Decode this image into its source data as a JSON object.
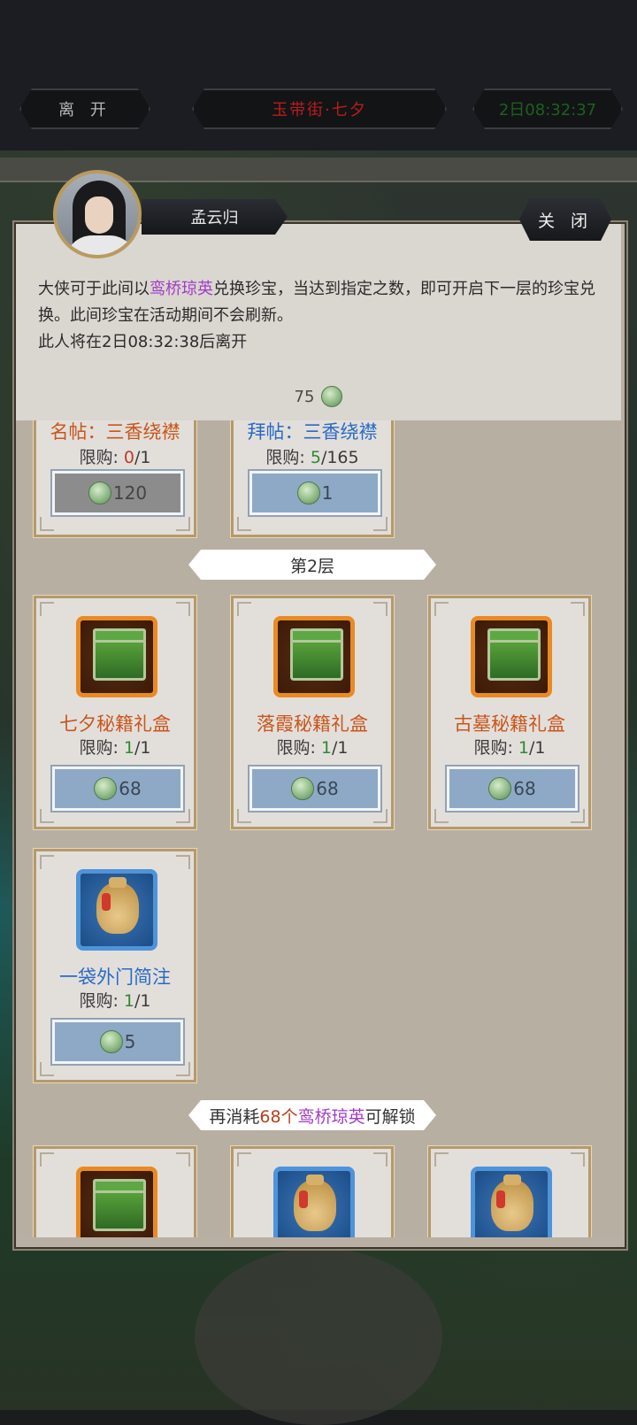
{
  "header": {
    "leave_label": "离 开",
    "location_title": "玉带街·七夕",
    "timer": "2日08:32:37"
  },
  "npc": {
    "name": "孟云归",
    "close_label": "关 闭",
    "desc_part1": "大侠可于此间以",
    "desc_currency": "鸾桥琼英",
    "desc_part2": "兑换珍宝，当达到指定之数，即可开启下一层的珍宝兑换。此间珍宝在活动期间不会刷新。",
    "leave_notice": "此人将在2日08:32:38后离开",
    "currency_amount": "75",
    "currency_icon": "jade-coin-icon"
  },
  "shop": {
    "limit_prefix": "限购: ",
    "tier1_items": [
      {
        "name": "名帖：三香绕襟",
        "color": "orange",
        "bought": "0",
        "max": "1",
        "price": "120",
        "price_state": "disabled"
      },
      {
        "name": "拜帖：三香绕襟",
        "color": "blue",
        "bought": "5",
        "max": "165",
        "price": "1",
        "price_state": "enabled"
      }
    ],
    "tier2_label": "第2层",
    "tier2_items": [
      {
        "name": "七夕秘籍礼盒",
        "color": "orange",
        "icon": "green-chest-icon",
        "bought": "1",
        "max": "1",
        "price": "68"
      },
      {
        "name": "落霞秘籍礼盒",
        "color": "orange",
        "icon": "green-chest-icon",
        "bought": "1",
        "max": "1",
        "price": "68"
      },
      {
        "name": "古墓秘籍礼盒",
        "color": "orange",
        "icon": "green-chest-icon",
        "bought": "1",
        "max": "1",
        "price": "68"
      },
      {
        "name": "一袋外门简注",
        "color": "blue",
        "icon": "silk-bag-icon",
        "bought": "1",
        "max": "1",
        "price": "5"
      }
    ],
    "unlock_banner": {
      "prefix": "再消耗",
      "count": "68个",
      "currency": "鸾桥琼英",
      "suffix": "可解锁"
    },
    "tier3_preview_icons": [
      "green-chest-icon",
      "silk-bag-icon",
      "silk-bag-icon"
    ]
  },
  "colors": {
    "orange_text": "#c9561b",
    "blue_text": "#2a6ac6",
    "highlight_purple": "#a23cc7",
    "limit_green": "#2f8a2f",
    "title_red": "#b81d1d"
  }
}
